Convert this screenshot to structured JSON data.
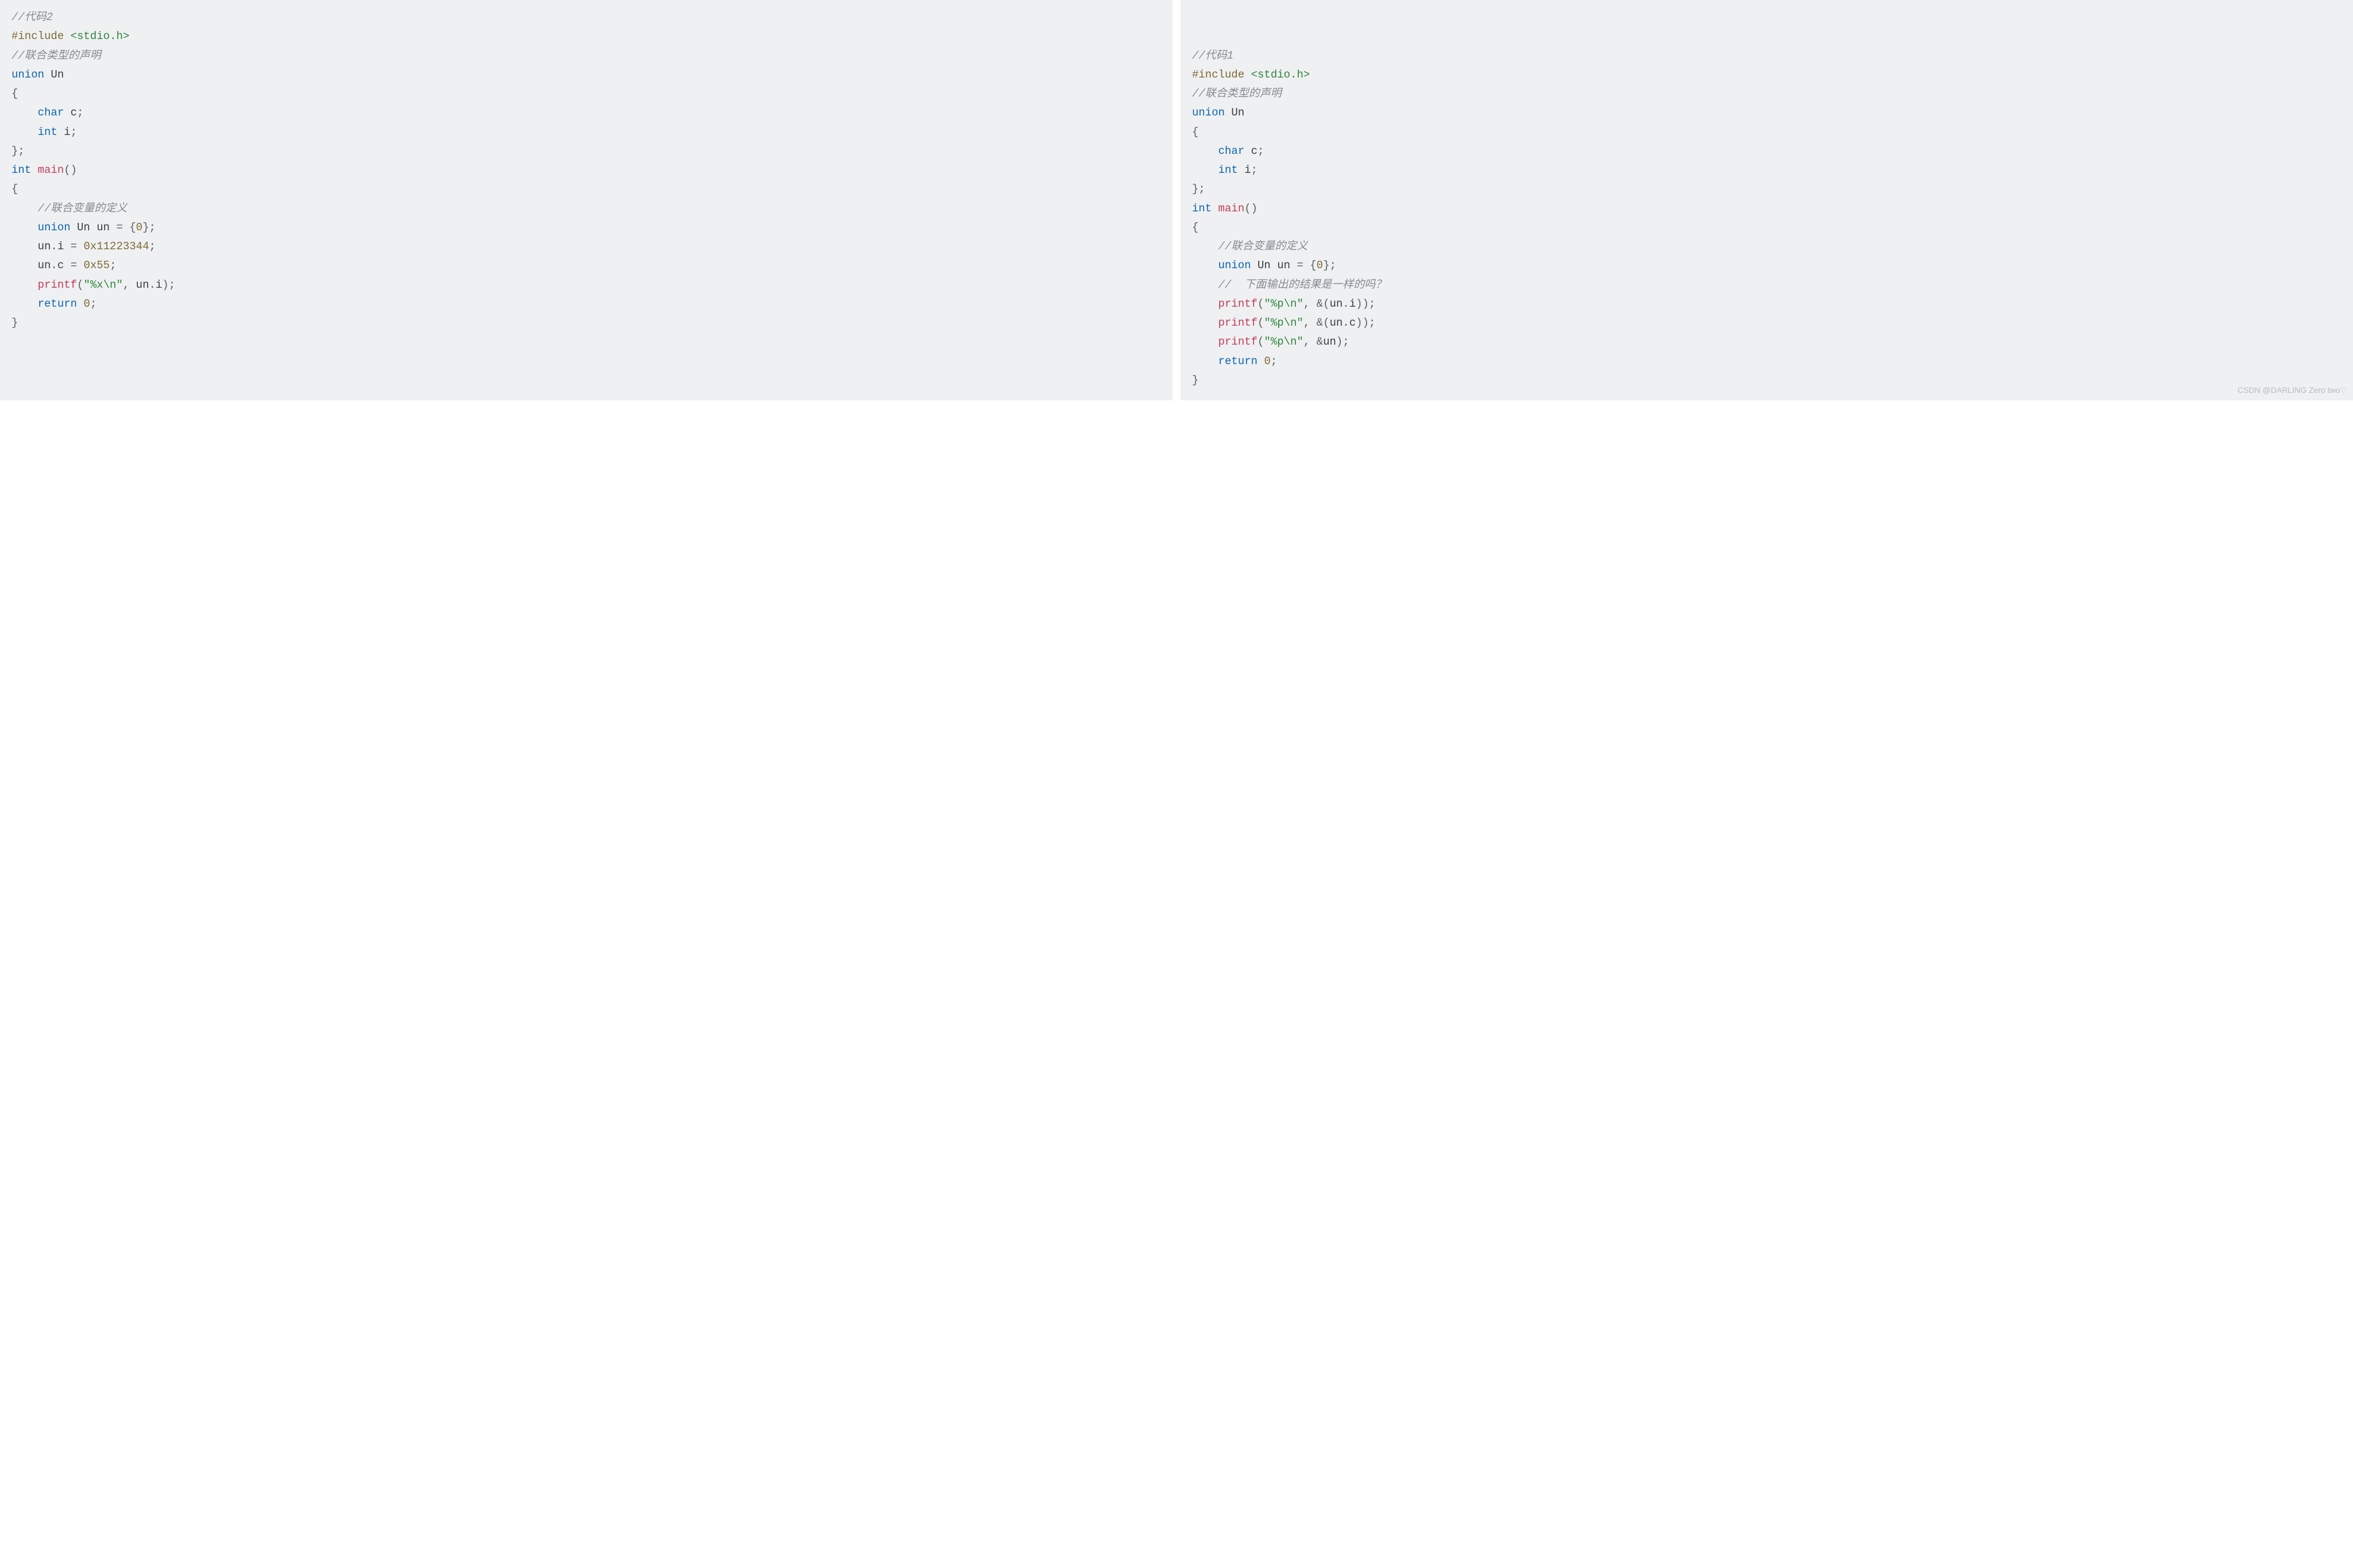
{
  "left": {
    "lines": [
      [
        {
          "cls": "comment",
          "t": "//代码2"
        }
      ],
      [
        {
          "cls": "preproc",
          "t": "#include"
        },
        {
          "cls": "",
          "t": " "
        },
        {
          "cls": "include-path",
          "t": "<stdio.h>"
        }
      ],
      [
        {
          "cls": "comment",
          "t": "//联合类型的声明"
        }
      ],
      [
        {
          "cls": "keyword",
          "t": "union"
        },
        {
          "cls": "",
          "t": " "
        },
        {
          "cls": "ident",
          "t": "Un"
        }
      ],
      [
        {
          "cls": "punct",
          "t": "{"
        }
      ],
      [
        {
          "cls": "",
          "t": "    "
        },
        {
          "cls": "type",
          "t": "char"
        },
        {
          "cls": "",
          "t": " "
        },
        {
          "cls": "ident",
          "t": "c"
        },
        {
          "cls": "punct",
          "t": ";"
        }
      ],
      [
        {
          "cls": "",
          "t": "    "
        },
        {
          "cls": "type",
          "t": "int"
        },
        {
          "cls": "",
          "t": " "
        },
        {
          "cls": "ident",
          "t": "i"
        },
        {
          "cls": "punct",
          "t": ";"
        }
      ],
      [
        {
          "cls": "punct",
          "t": "};"
        }
      ],
      [
        {
          "cls": "type",
          "t": "int"
        },
        {
          "cls": "",
          "t": " "
        },
        {
          "cls": "func",
          "t": "main"
        },
        {
          "cls": "punct",
          "t": "()"
        }
      ],
      [
        {
          "cls": "punct",
          "t": "{"
        }
      ],
      [
        {
          "cls": "",
          "t": "    "
        },
        {
          "cls": "comment",
          "t": "//联合变量的定义"
        }
      ],
      [
        {
          "cls": "",
          "t": "    "
        },
        {
          "cls": "keyword",
          "t": "union"
        },
        {
          "cls": "",
          "t": " "
        },
        {
          "cls": "ident",
          "t": "Un un "
        },
        {
          "cls": "punct",
          "t": "= {"
        },
        {
          "cls": "number",
          "t": "0"
        },
        {
          "cls": "punct",
          "t": "};"
        }
      ],
      [
        {
          "cls": "",
          "t": "    "
        },
        {
          "cls": "ident",
          "t": "un"
        },
        {
          "cls": "punct",
          "t": "."
        },
        {
          "cls": "ident",
          "t": "i "
        },
        {
          "cls": "punct",
          "t": "= "
        },
        {
          "cls": "number",
          "t": "0x11223344"
        },
        {
          "cls": "punct",
          "t": ";"
        }
      ],
      [
        {
          "cls": "",
          "t": "    "
        },
        {
          "cls": "ident",
          "t": "un"
        },
        {
          "cls": "punct",
          "t": "."
        },
        {
          "cls": "ident",
          "t": "c "
        },
        {
          "cls": "punct",
          "t": "= "
        },
        {
          "cls": "number",
          "t": "0x55"
        },
        {
          "cls": "punct",
          "t": ";"
        }
      ],
      [
        {
          "cls": "",
          "t": "    "
        },
        {
          "cls": "func",
          "t": "printf"
        },
        {
          "cls": "punct",
          "t": "("
        },
        {
          "cls": "string",
          "t": "\"%x\\n\""
        },
        {
          "cls": "punct",
          "t": ", "
        },
        {
          "cls": "ident",
          "t": "un"
        },
        {
          "cls": "punct",
          "t": "."
        },
        {
          "cls": "ident",
          "t": "i"
        },
        {
          "cls": "punct",
          "t": ");"
        }
      ],
      [
        {
          "cls": "",
          "t": "    "
        },
        {
          "cls": "keyword",
          "t": "return"
        },
        {
          "cls": "",
          "t": " "
        },
        {
          "cls": "number",
          "t": "0"
        },
        {
          "cls": "punct",
          "t": ";"
        }
      ],
      [
        {
          "cls": "punct",
          "t": "}"
        }
      ]
    ]
  },
  "right": {
    "lines": [
      [
        {
          "cls": "comment",
          "t": "//代码1"
        }
      ],
      [
        {
          "cls": "preproc",
          "t": "#include"
        },
        {
          "cls": "",
          "t": " "
        },
        {
          "cls": "include-path",
          "t": "<stdio.h>"
        }
      ],
      [
        {
          "cls": "comment",
          "t": "//联合类型的声明"
        }
      ],
      [
        {
          "cls": "keyword",
          "t": "union"
        },
        {
          "cls": "",
          "t": " "
        },
        {
          "cls": "ident",
          "t": "Un"
        }
      ],
      [
        {
          "cls": "punct",
          "t": "{"
        }
      ],
      [
        {
          "cls": "",
          "t": "    "
        },
        {
          "cls": "type",
          "t": "char"
        },
        {
          "cls": "",
          "t": " "
        },
        {
          "cls": "ident",
          "t": "c"
        },
        {
          "cls": "punct",
          "t": ";"
        }
      ],
      [
        {
          "cls": "",
          "t": "    "
        },
        {
          "cls": "type",
          "t": "int"
        },
        {
          "cls": "",
          "t": " "
        },
        {
          "cls": "ident",
          "t": "i"
        },
        {
          "cls": "punct",
          "t": ";"
        }
      ],
      [
        {
          "cls": "punct",
          "t": "};"
        }
      ],
      [
        {
          "cls": "type",
          "t": "int"
        },
        {
          "cls": "",
          "t": " "
        },
        {
          "cls": "func",
          "t": "main"
        },
        {
          "cls": "punct",
          "t": "()"
        }
      ],
      [
        {
          "cls": "punct",
          "t": "{"
        }
      ],
      [
        {
          "cls": "",
          "t": "    "
        },
        {
          "cls": "comment",
          "t": "//联合变量的定义"
        }
      ],
      [
        {
          "cls": "",
          "t": "    "
        },
        {
          "cls": "keyword",
          "t": "union"
        },
        {
          "cls": "",
          "t": " "
        },
        {
          "cls": "ident",
          "t": "Un un "
        },
        {
          "cls": "punct",
          "t": "= {"
        },
        {
          "cls": "number",
          "t": "0"
        },
        {
          "cls": "punct",
          "t": "};"
        }
      ],
      [
        {
          "cls": "",
          "t": "    "
        },
        {
          "cls": "comment",
          "t": "//  下面输出的结果是一样的吗？"
        }
      ],
      [
        {
          "cls": "",
          "t": "    "
        },
        {
          "cls": "func",
          "t": "printf"
        },
        {
          "cls": "punct",
          "t": "("
        },
        {
          "cls": "string",
          "t": "\"%p\\n\""
        },
        {
          "cls": "punct",
          "t": ", &("
        },
        {
          "cls": "ident",
          "t": "un"
        },
        {
          "cls": "punct",
          "t": "."
        },
        {
          "cls": "ident",
          "t": "i"
        },
        {
          "cls": "punct",
          "t": "));"
        }
      ],
      [
        {
          "cls": "",
          "t": "    "
        },
        {
          "cls": "func",
          "t": "printf"
        },
        {
          "cls": "punct",
          "t": "("
        },
        {
          "cls": "string",
          "t": "\"%p\\n\""
        },
        {
          "cls": "punct",
          "t": ", &("
        },
        {
          "cls": "ident",
          "t": "un"
        },
        {
          "cls": "punct",
          "t": "."
        },
        {
          "cls": "ident",
          "t": "c"
        },
        {
          "cls": "punct",
          "t": "));"
        }
      ],
      [
        {
          "cls": "",
          "t": "    "
        },
        {
          "cls": "func",
          "t": "printf"
        },
        {
          "cls": "punct",
          "t": "("
        },
        {
          "cls": "string",
          "t": "\"%p\\n\""
        },
        {
          "cls": "punct",
          "t": ", &"
        },
        {
          "cls": "ident",
          "t": "un"
        },
        {
          "cls": "punct",
          "t": ");"
        }
      ],
      [
        {
          "cls": "",
          "t": "    "
        },
        {
          "cls": "keyword",
          "t": "return"
        },
        {
          "cls": "",
          "t": " "
        },
        {
          "cls": "number",
          "t": "0"
        },
        {
          "cls": "punct",
          "t": ";"
        }
      ],
      [
        {
          "cls": "punct",
          "t": "}"
        }
      ]
    ]
  },
  "watermark": "CSDN @DARLING Zero two♡"
}
